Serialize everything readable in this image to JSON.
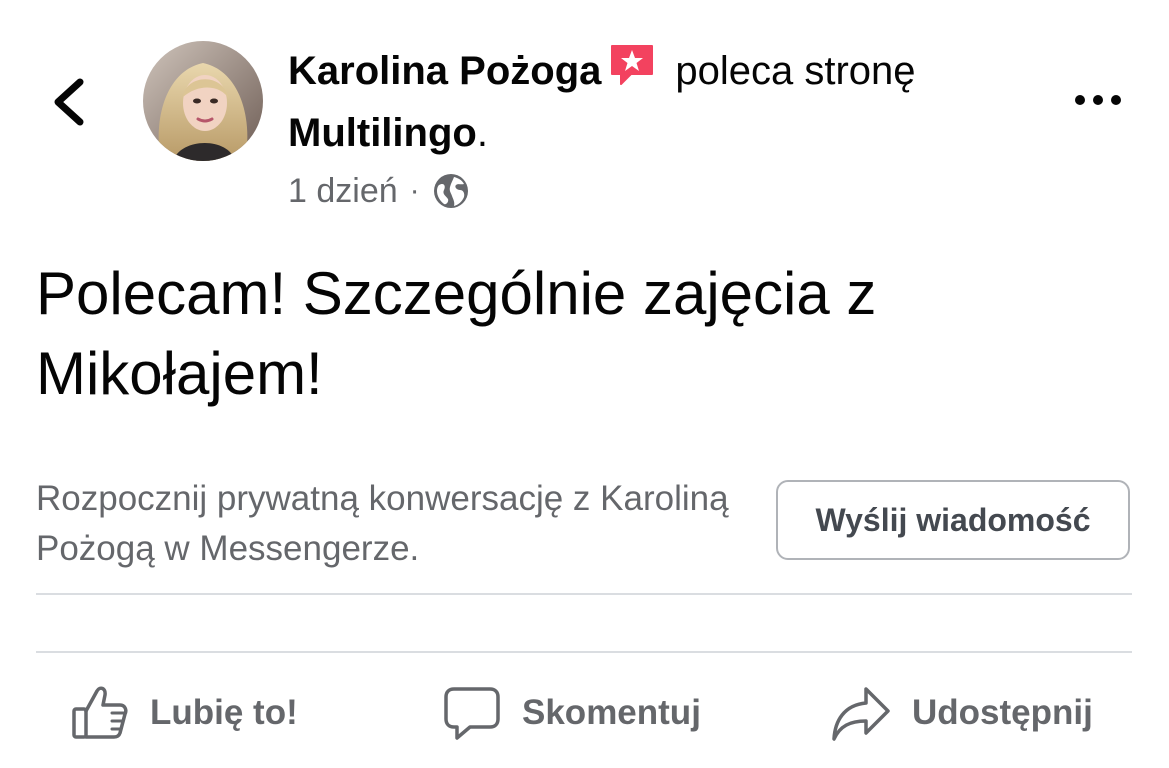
{
  "header": {
    "author_name": "Karolina Pożoga",
    "action_text": "poleca stronę",
    "page_name": "Multilingo",
    "period": ".",
    "timestamp": "1 dzień",
    "separator": "·",
    "audience_icon": "globe-icon",
    "back_icon": "chevron-left-icon",
    "more_icon": "more-horizontal-icon",
    "recommend_icon": "recommendation-badge-icon"
  },
  "post": {
    "text": "Polecam! Szczególnie zajęcia z Mikołajem!"
  },
  "messenger_cta": {
    "text": "Rozpocznij prywatną konwersację z Karoliną Pożogą w Messengerze.",
    "button_label": "Wyślij wiadomość"
  },
  "actions": {
    "like_label": "Lubię to!",
    "comment_label": "Skomentuj",
    "share_label": "Udostępnij",
    "like_icon": "thumbs-up-icon",
    "comment_icon": "comment-bubble-icon",
    "share_icon": "share-arrow-icon"
  },
  "colors": {
    "primary_text": "#050505",
    "secondary_text": "#65676b",
    "badge_red": "#f3425f",
    "divider": "#dadde1"
  }
}
